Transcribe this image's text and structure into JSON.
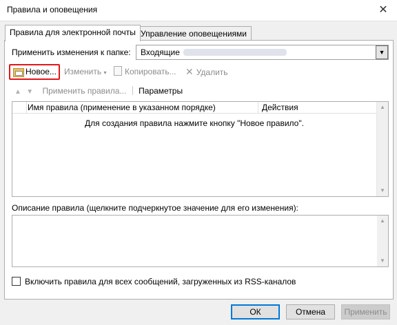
{
  "window": {
    "title": "Правила и оповещения",
    "close_glyph": "✕"
  },
  "tabs": [
    {
      "label": "Правила для электронной почты",
      "active": true
    },
    {
      "label": "Управление оповещениями",
      "active": false
    }
  ],
  "folder": {
    "label": "Применить изменения к папке:",
    "value": "Входящие"
  },
  "toolbar": {
    "new_label": "Новое...",
    "edit_label": "Изменить",
    "copy_label": "Копировать...",
    "delete_label": "Удалить"
  },
  "row2": {
    "apply_rules_label": "Применить правила...",
    "options_label": "Параметры"
  },
  "rules_list": {
    "col_name": "Имя правила (применение в указанном порядке)",
    "col_actions": "Действия",
    "empty_text": "Для создания правила нажмите кнопку \"Новое правило\"."
  },
  "description": {
    "label": "Описание правила (щелкните подчеркнутое значение для его изменения):"
  },
  "rss": {
    "label": "Включить правила для всех сообщений, загруженных из RSS-каналов",
    "checked": false
  },
  "buttons": {
    "ok": "ОК",
    "cancel": "Отмена",
    "apply": "Применить"
  },
  "colors": {
    "highlight_border": "#e0161a",
    "default_button_border": "#0078d7"
  }
}
